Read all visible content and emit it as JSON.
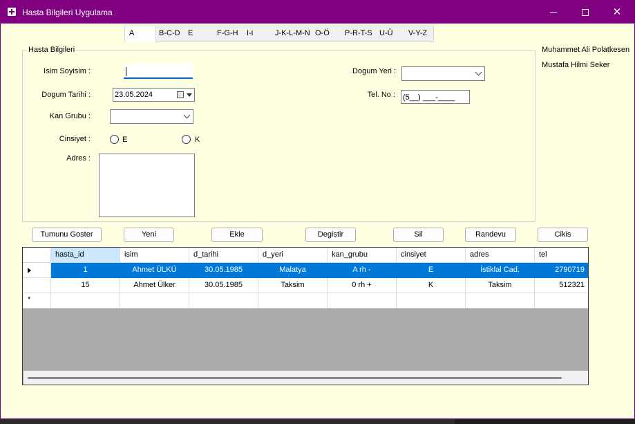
{
  "window": {
    "title": "Hasta Bilgileri Uygulama",
    "controls": {
      "minimize": "minimize",
      "maximize": "maximize",
      "close": "✕"
    }
  },
  "letter_tabs": [
    "A",
    "B-C-D",
    "E",
    "F-G-H",
    "I-i",
    "J-K-L-M-N",
    "O-Ö",
    "P-R-T-S",
    "U-Ü",
    "V-Y-Z"
  ],
  "form": {
    "group_title": "Hasta Bilgileri",
    "name_label": "Isim Soyisim :",
    "name_value": "",
    "birthdate_label": "Dogum Tarihi :",
    "birthdate_value": "23.05.2024",
    "blood_label": "Kan Grubu :",
    "blood_value": "",
    "gender_label": "Cinsiyet :",
    "gender_options": [
      "E",
      "K"
    ],
    "address_label": "Adres :",
    "address_value": "",
    "birthplace_label": "Dogum Yeri :",
    "birthplace_value": "",
    "phone_label": "Tel. No :",
    "phone_value": "(5__) ___-____"
  },
  "authors": [
    "Muhammet Ali Polatkesen",
    "Mustafa Hilmi Seker"
  ],
  "buttons": [
    "Tumunu Goster",
    "Yeni",
    "Ekle",
    "Degistir",
    "Sil",
    "Randevu",
    "Cikis"
  ],
  "grid": {
    "columns": [
      "hasta_id",
      "isim",
      "d_tarihi",
      "d_yeri",
      "kan_grubu",
      "cinsiyet",
      "adres",
      "tel"
    ],
    "rows": [
      [
        "1",
        "Ahmet ÜLKÜ",
        "30.05.1985",
        "Malatya",
        "A rh -",
        "E",
        "İstiklal Cad.",
        "2790719"
      ],
      [
        "15",
        "Ahmet Ülker",
        "30.05.1985",
        "Taksim",
        "0 rh +",
        "K",
        "Taksim",
        "512321"
      ]
    ],
    "new_row_marker": "*"
  },
  "colors": {
    "titlebar": "#800080",
    "window_bg": "#ffffe1",
    "selection": "#0078d7"
  }
}
